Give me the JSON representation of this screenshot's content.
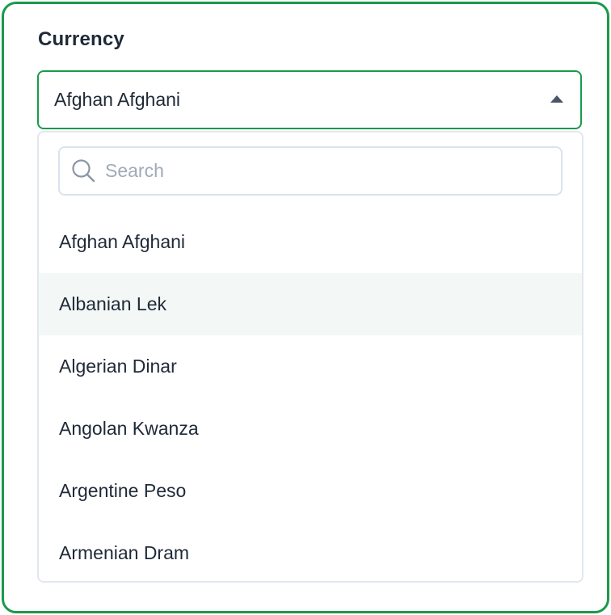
{
  "field": {
    "label": "Currency",
    "selected_value": "Afghan Afghani"
  },
  "search": {
    "placeholder": "Search",
    "value": ""
  },
  "options": [
    {
      "label": "Afghan Afghani"
    },
    {
      "label": "Albanian Lek"
    },
    {
      "label": "Algerian Dinar"
    },
    {
      "label": "Angolan Kwanza"
    },
    {
      "label": "Argentine Peso"
    },
    {
      "label": "Armenian Dram"
    }
  ],
  "colors": {
    "accent": "#1a9a4a",
    "hover_row": "#f3f8f6",
    "text": "#1f2937",
    "placeholder": "#a0aab8"
  },
  "icons": {
    "search": "search-icon",
    "caret": "caret-up-icon"
  }
}
